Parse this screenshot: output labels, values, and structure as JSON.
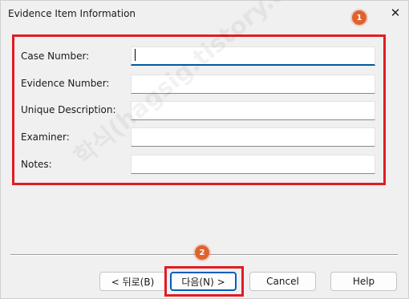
{
  "window": {
    "title": "Evidence Item Information",
    "close_glyph": "✕"
  },
  "form": {
    "fields": [
      {
        "label": "Case Number:",
        "value": ""
      },
      {
        "label": "Evidence Number:",
        "value": ""
      },
      {
        "label": "Unique Description:",
        "value": ""
      },
      {
        "label": "Examiner:",
        "value": ""
      },
      {
        "label": "Notes:",
        "value": ""
      }
    ]
  },
  "buttons": {
    "back": "< 뒤로(B)",
    "next": "다음(N) >",
    "cancel": "Cancel",
    "help": "Help"
  },
  "annotations": {
    "badge_1": "1",
    "badge_2": "2",
    "highlight_color": "#e01c24",
    "badge_color": "#e0622f"
  },
  "watermark": "학식(hagsig.tistory.com)"
}
